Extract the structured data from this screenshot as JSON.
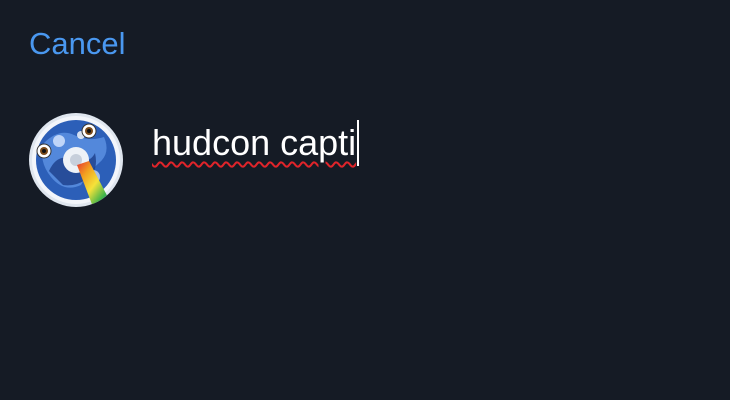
{
  "header": {
    "cancel_label": "Cancel"
  },
  "composer": {
    "avatar_icon": "profile-avatar-icon",
    "text": "hudcon capti"
  },
  "colors": {
    "background": "#151b25",
    "accent": "#4a98f0",
    "text": "#ffffff",
    "spellcheck": "#e0242a"
  }
}
